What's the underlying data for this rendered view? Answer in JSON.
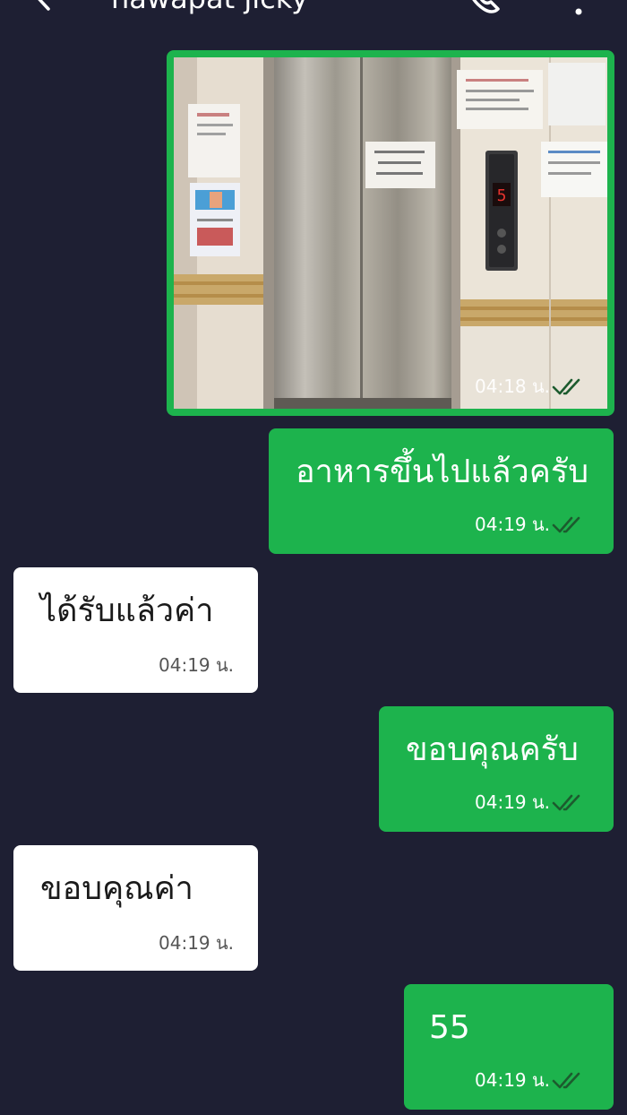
{
  "header": {
    "contact_name": "nawapat jicky"
  },
  "image_message": {
    "time": "04:18 น.",
    "status": "read",
    "image_semantic": "elevator-photo",
    "floor_display": "5"
  },
  "messages": [
    {
      "direction": "outgoing",
      "text": "อาหารขึ้นไปแล้วครับ",
      "time": "04:19 น.",
      "status": "read"
    },
    {
      "direction": "incoming",
      "text": "ได้รับแล้วค่า",
      "time": "04:19 น."
    },
    {
      "direction": "outgoing",
      "text": "ขอบคุณครับ",
      "time": "04:19 น.",
      "status": "read"
    },
    {
      "direction": "incoming",
      "text": "ขอบคุณค่า",
      "time": "04:19 น."
    },
    {
      "direction": "outgoing",
      "text": "55",
      "time": "04:19 น.",
      "status": "read"
    }
  ],
  "colors": {
    "background": "#1e1f33",
    "outgoing_bubble": "#1db34d",
    "incoming_bubble": "#ffffff",
    "read_check": "#1c5b2e"
  },
  "icons": {
    "back": "back-arrow-icon",
    "call": "phone-icon",
    "menu": "more-vert-icon",
    "status": "double-check-icon"
  }
}
